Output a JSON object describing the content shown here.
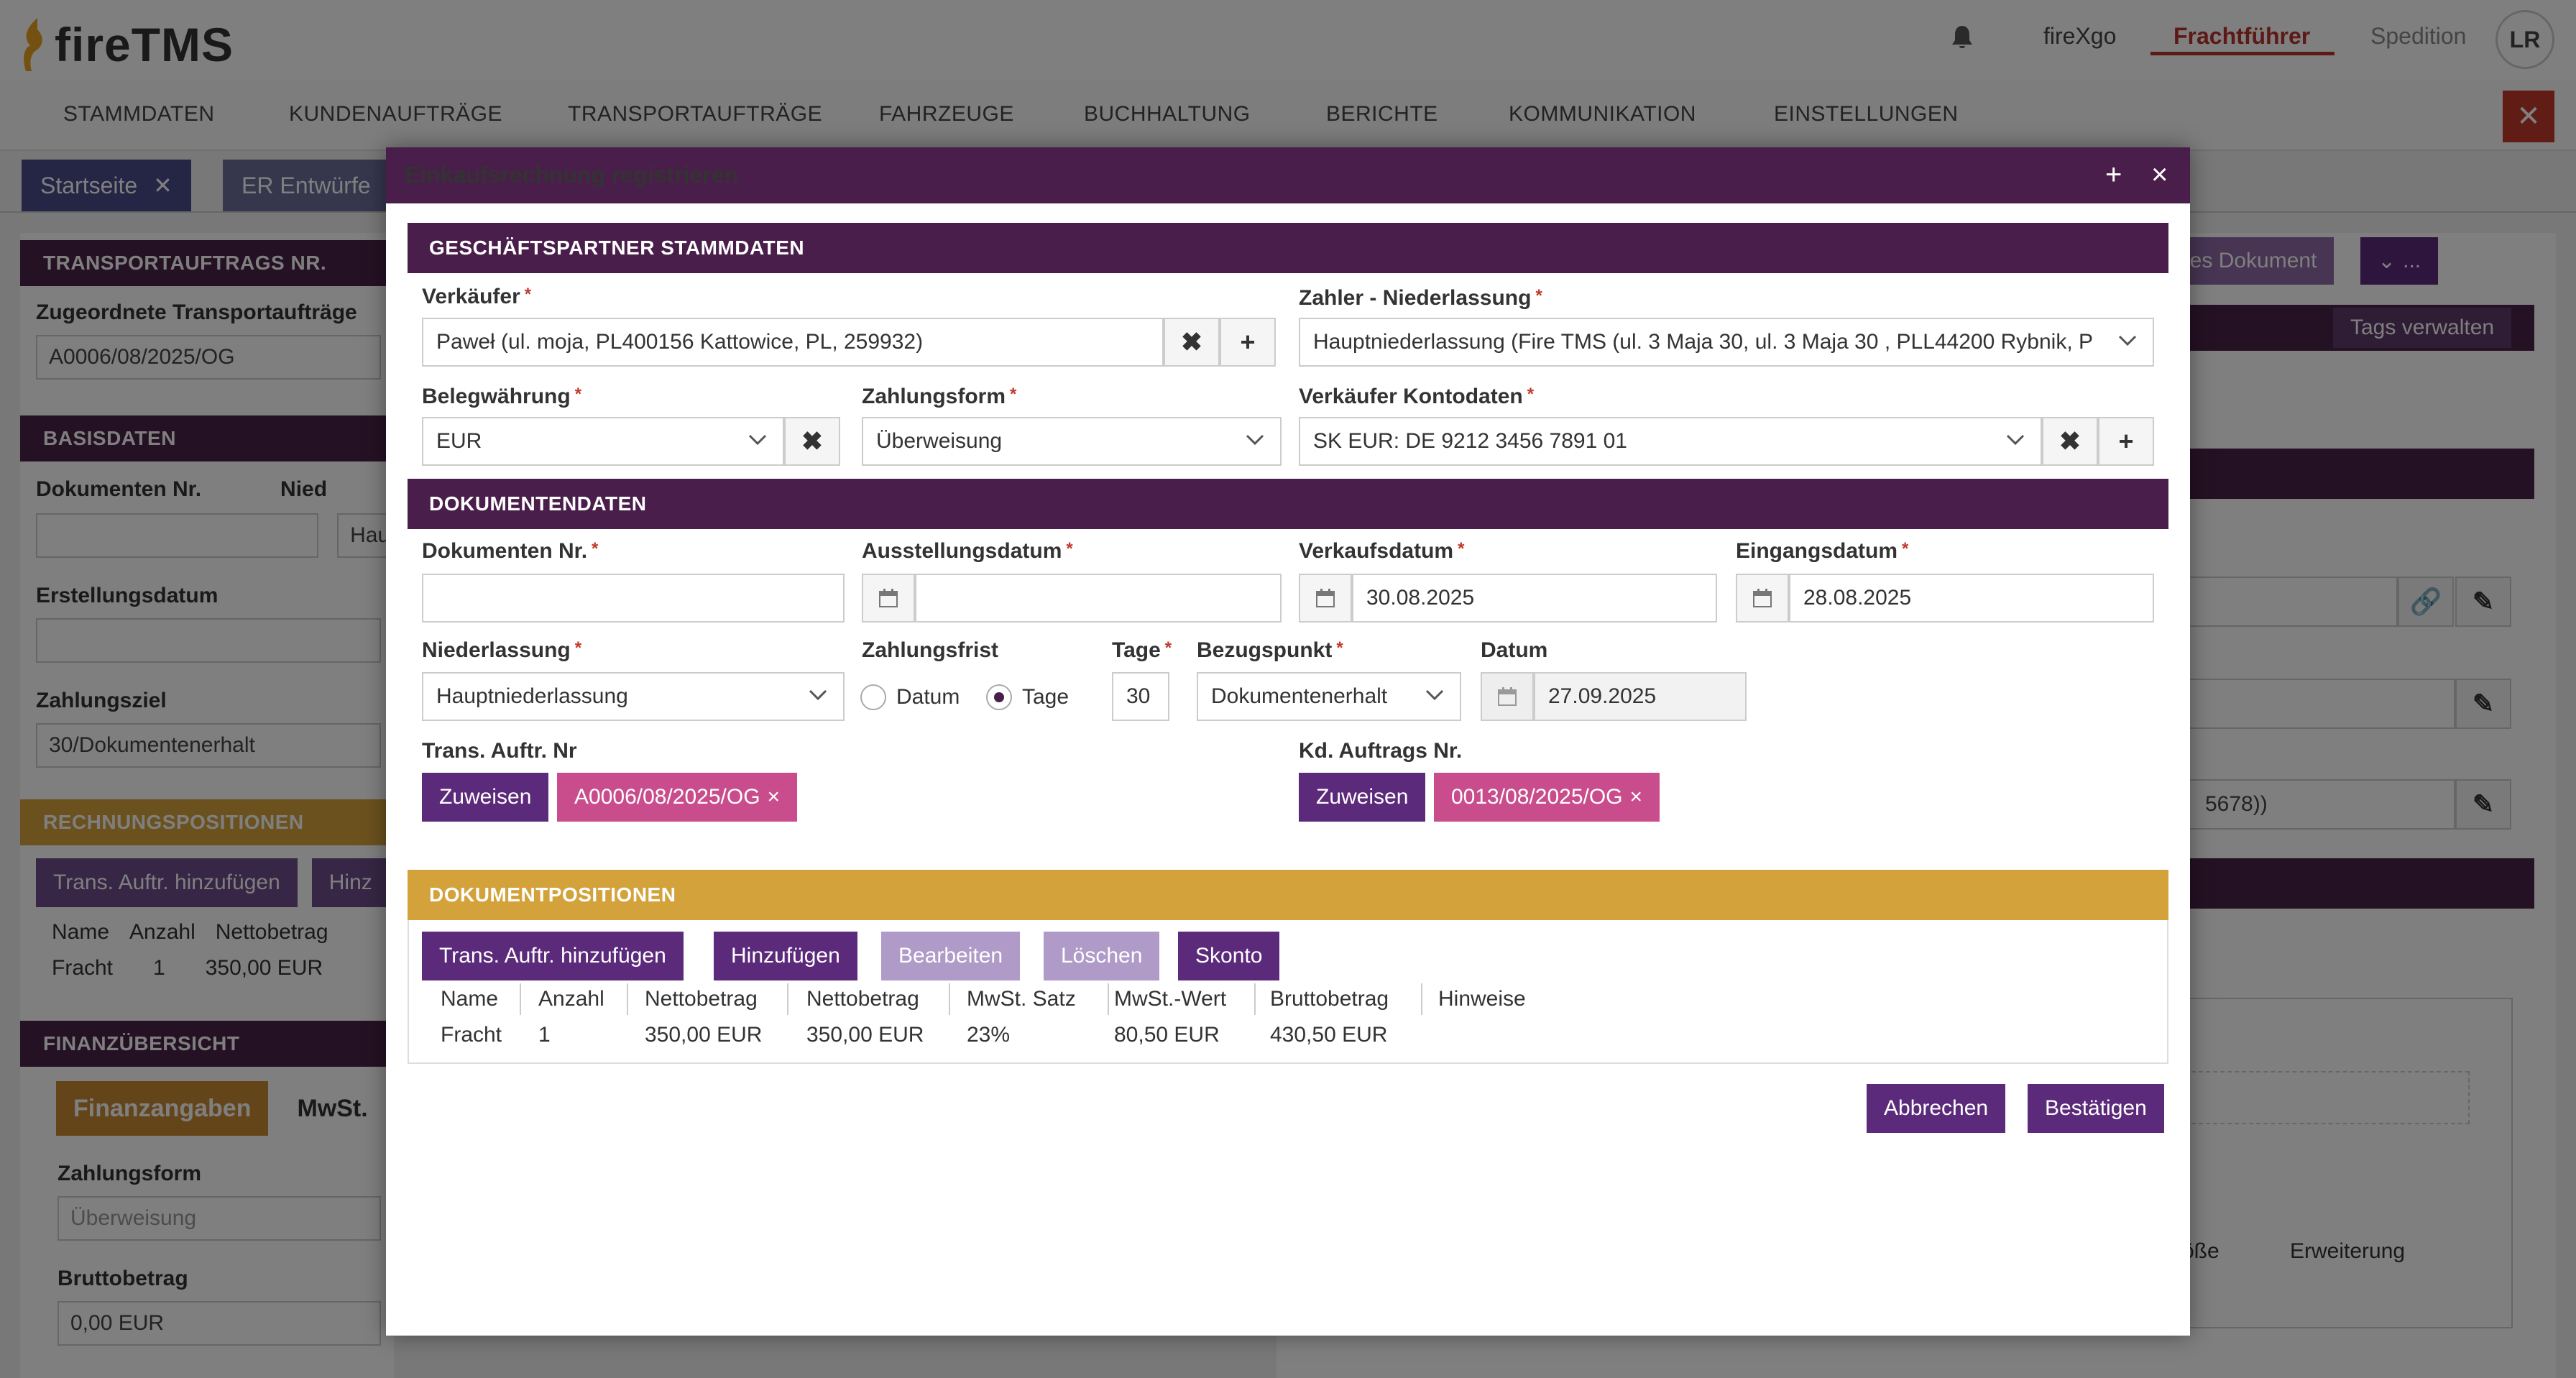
{
  "header": {
    "logo_text": "fireTMS",
    "company": "fireXgo",
    "role_active": "Frachtführer",
    "role_other": "Spedition",
    "avatar_initials": "LR"
  },
  "nav": [
    "STAMMDATEN",
    "KUNDENAUFTRÄGE",
    "TRANSPORTAUFTRÄGE",
    "FAHRZEUGE",
    "BUCHHALTUNG",
    "BERICHTE",
    "KOMMUNIKATION",
    "EINSTELLUNGEN"
  ],
  "tabs": [
    {
      "label": "Startseite"
    },
    {
      "label": "ER Entwürfe"
    }
  ],
  "background": {
    "transport_header": "TRANSPORTAUFTRAGS NR.",
    "assigned_label": "Zugeordnete Transportaufträge",
    "assigned_value": "A0006/08/2025/OG",
    "basis_header": "BASISDATEN",
    "doc_nr_label": "Dokumenten Nr.",
    "nied_label": "Nied",
    "nied_value": "Hau",
    "creation_label": "Erstellungsdatum",
    "payment_goal_label": "Zahlungsziel",
    "payment_goal_value": "30/Dokumentenerhalt",
    "positions_header": "RECHNUNGSPOSITIONEN",
    "add_transport_btn": "Trans. Auftr. hinzufügen",
    "add_btn_partial": "Hinz",
    "col_name": "Name",
    "col_count": "Anzahl",
    "col_net": "Nettobetrag",
    "row_name": "Fracht",
    "row_count": "1",
    "row_net": "350,00 EUR",
    "finance_header": "FINANZÜBERSICHT",
    "finance_tab": "Finanzangaben",
    "vat_tab": "MwSt.",
    "payment_form_label": "Zahlungsform",
    "payment_form_value": "Überweisung",
    "gross_label": "Bruttobetrag",
    "gross_value": "0,00 EUR",
    "new_document_btn": "ges Dokument",
    "more_btn": "...",
    "tags_btn": "Tags verwalten",
    "account_partial": "5678))",
    "size_label": "röße",
    "extension_label": "Erweiterung"
  },
  "modal": {
    "title": "Einkaufsrechnung registrieren",
    "section_partner": "GESCHÄFTSPARTNER STAMMDATEN",
    "seller_label": "Verkäufer",
    "seller_value": "Paweł (ul. moja, PL400156 Kattowice, PL, 259932)",
    "payer_label": "Zahler - Niederlassung",
    "payer_value": "Hauptniederlassung (Fire TMS  (ul. 3 Maja 30, ul. 3 Maja 30 , PLL44200 Rybnik, P",
    "currency_label": "Belegwährung",
    "currency_value": "EUR",
    "payment_form_label": "Zahlungsform",
    "payment_form_value": "Überweisung",
    "seller_account_label": "Verkäufer Kontodaten",
    "seller_account_value": "SK EUR: DE 9212 3456 7891 01",
    "section_document": "DOKUMENTENDATEN",
    "doc_nr_label": "Dokumenten Nr.",
    "doc_nr_value": "",
    "issue_date_label": "Ausstellungsdatum",
    "issue_date_value": "",
    "sale_date_label": "Verkaufsdatum",
    "sale_date_value": "30.08.2025",
    "receipt_date_label": "Eingangsdatum",
    "receipt_date_value": "28.08.2025",
    "branch_label": "Niederlassung",
    "branch_value": "Hauptniederlassung",
    "payment_term_label": "Zahlungsfrist",
    "radio_date": "Datum",
    "radio_days": "Tage",
    "days_label": "Tage",
    "days_value": "30",
    "reference_label": "Bezugspunkt",
    "reference_value": "Dokumentenerhalt",
    "date_label": "Datum",
    "date_value": "27.09.2025",
    "trans_order_label": "Trans. Auftr. Nr",
    "assign_btn": "Zuweisen",
    "trans_order_tag": "A0006/08/2025/OG",
    "customer_order_label": "Kd. Auftrags Nr.",
    "customer_order_tag": "0013/08/2025/OG",
    "tag_remove": "×",
    "section_positions": "DOKUMENTPOSITIONEN",
    "btn_add_transport": "Trans. Auftr. hinzufügen",
    "btn_add": "Hinzufügen",
    "btn_edit": "Bearbeiten",
    "btn_delete": "Löschen",
    "btn_discount": "Skonto",
    "columns": [
      "Name",
      "Anzahl",
      "Nettobetrag",
      "Nettobetrag",
      "MwSt. Satz",
      "MwSt.-Wert",
      "Bruttobetrag",
      "Hinweise"
    ],
    "rows": [
      [
        "Fracht",
        "1",
        "350,00 EUR",
        "350,00 EUR",
        "23%",
        "80,50 EUR",
        "430,50 EUR",
        ""
      ]
    ],
    "cancel_btn": "Abbrechen",
    "confirm_btn": "Bestätigen",
    "header_plus": "+",
    "header_close": "×"
  },
  "colors": {
    "purple_dark": "#4a1e4b",
    "purple_button": "#5c2a7a",
    "gold": "#d4a23a",
    "pink_tag": "#c94d8c",
    "brand_red": "#b8322d"
  }
}
